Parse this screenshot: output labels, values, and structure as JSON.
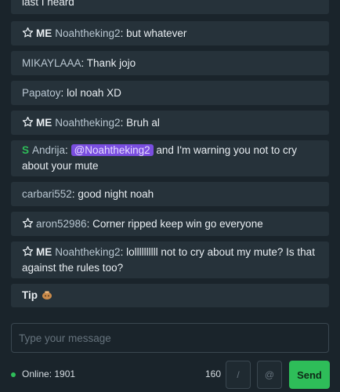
{
  "messages": [
    {
      "star": false,
      "me": false,
      "badge": "",
      "user": "",
      "sep": "",
      "mention": "",
      "text": "last I heard"
    },
    {
      "star": true,
      "me": true,
      "badge": "",
      "user": "Noahtheking2",
      "sep": ":",
      "mention": "",
      "text": " but whatever"
    },
    {
      "star": false,
      "me": false,
      "badge": "",
      "user": "MIKAYLAAA",
      "sep": ":",
      "mention": "",
      "text": " Thank jojo"
    },
    {
      "star": false,
      "me": false,
      "badge": "",
      "user": "Papatoy",
      "sep": ":",
      "mention": "",
      "text": " lol noah XD"
    },
    {
      "star": true,
      "me": true,
      "badge": "",
      "user": "Noahtheking2",
      "sep": ":",
      "mention": "",
      "text": " Bruh al"
    },
    {
      "star": false,
      "me": false,
      "badge": "S",
      "user": "Andrija",
      "sep": ":",
      "mention": "@Noahtheking2",
      "text": " and I'm warning you not to cry about your mute"
    },
    {
      "star": false,
      "me": false,
      "badge": "",
      "user": "carbari552",
      "sep": ":",
      "mention": "",
      "text": " good night noah"
    },
    {
      "star": true,
      "me": false,
      "badge": "",
      "user": "aron52986",
      "sep": ":",
      "mention": "",
      "text": " Corner ripped keep win go everyone"
    },
    {
      "star": true,
      "me": true,
      "badge": "",
      "user": "Noahtheking2",
      "sep": ":",
      "mention": "",
      "text": " lollllllllll not to cry about my mute? Is that against the rules too?"
    }
  ],
  "me_label": "ME",
  "tip": {
    "label": "Tip",
    "icon": "tip-bag-icon"
  },
  "composer": {
    "placeholder": "Type your message"
  },
  "footer": {
    "online_label": "Online: 1901",
    "char_count": "160",
    "slash_button": "/",
    "mention_button": "@",
    "send_button": "Send"
  },
  "colors": {
    "background": "#1a242b",
    "message_bg": "#26323a",
    "username": "#b9c7d2",
    "mention_bg": "#7a4ee0",
    "online_green": "#2ebd59",
    "send_green": "#2ebd59"
  }
}
